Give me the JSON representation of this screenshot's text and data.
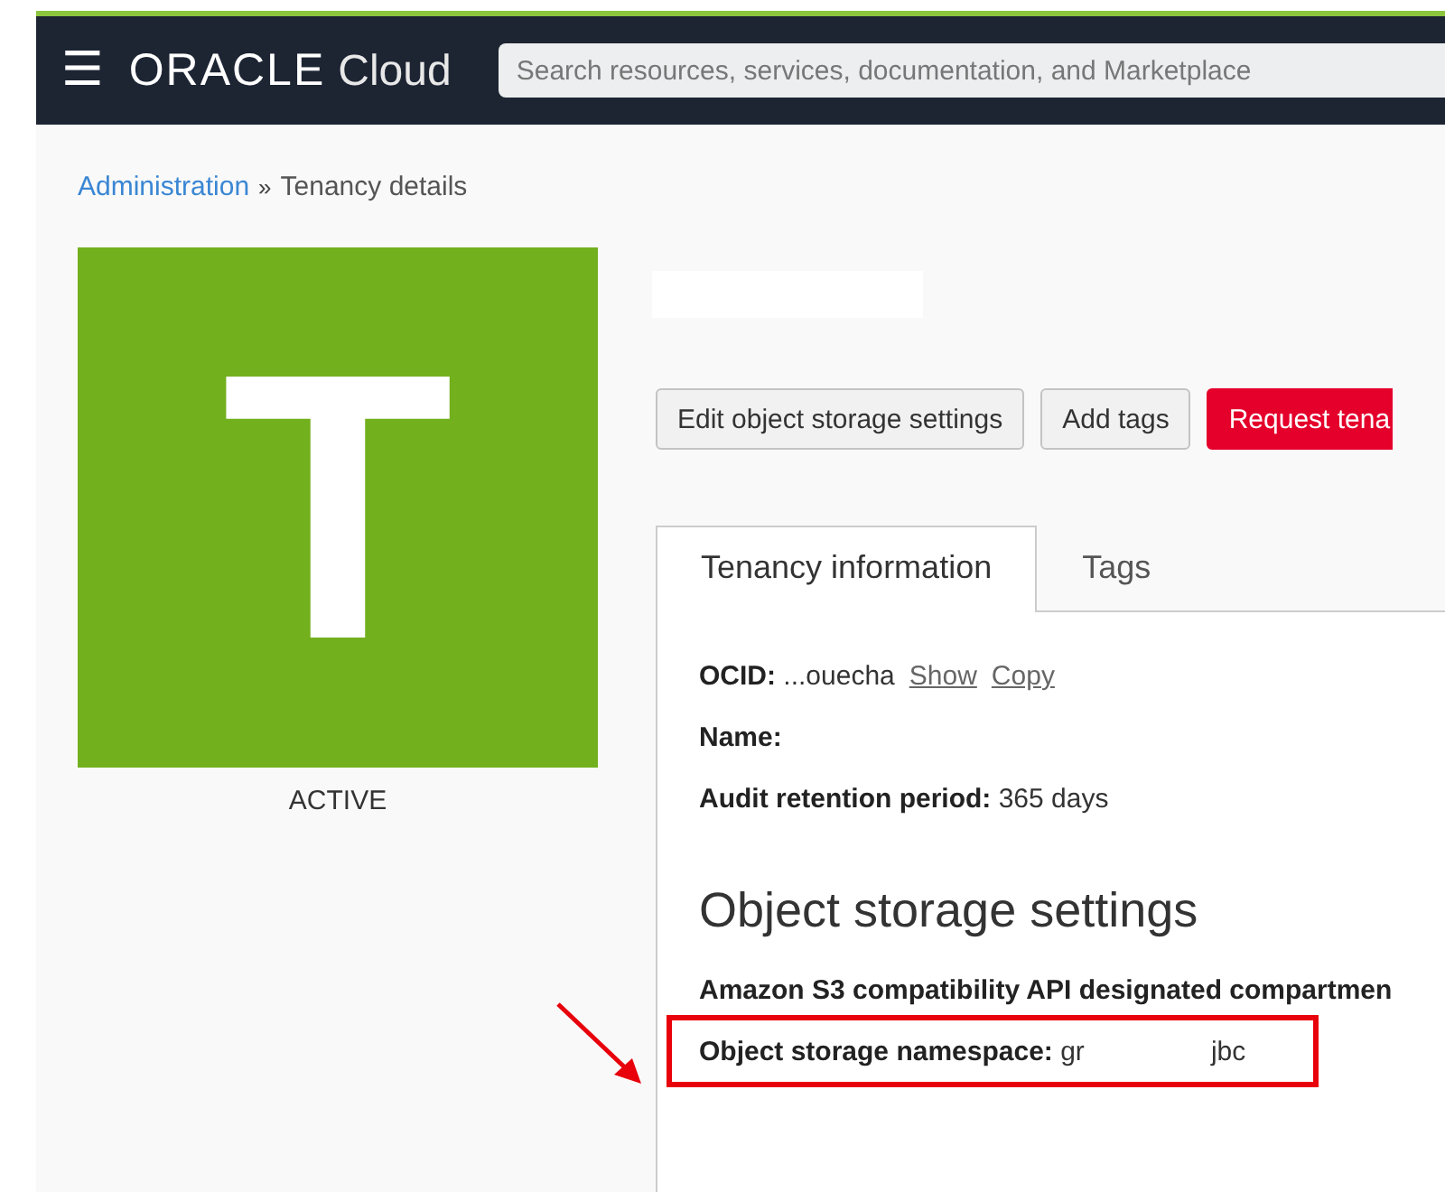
{
  "header": {
    "menu_icon": "☰",
    "logo_word": "ORACLE",
    "logo_product": "Cloud",
    "search": {
      "placeholder": "Search resources, services, documentation, and Marketplace"
    }
  },
  "breadcrumb_separator": "»",
  "breadcrumb": [
    {
      "label": "Administration",
      "kind": "link"
    },
    {
      "label": "Tenancy details",
      "kind": "current"
    }
  ],
  "tenancy": {
    "avatar_letter": "T",
    "status": "ACTIVE",
    "color": "#72b01d"
  },
  "buttons": [
    {
      "label": "Edit object storage settings",
      "kind": "secondary"
    },
    {
      "label": "Add tags",
      "kind": "secondary"
    },
    {
      "label": "Request tena",
      "kind": "danger"
    }
  ],
  "tabs": [
    {
      "label": "Tenancy information",
      "selected": true
    },
    {
      "label": "Tags",
      "selected": false
    }
  ],
  "info": [
    {
      "label": "OCID:",
      "value": "...ouecha",
      "links": [
        "Show",
        "Copy"
      ]
    },
    {
      "label": "Name:"
    },
    {
      "label": "Audit retention period:",
      "value": "365 days"
    }
  ],
  "object_storage": {
    "heading": "Object storage settings",
    "fields": [
      {
        "label": "Amazon S3 compatibility API designated compartmen",
        "highlighted": false
      },
      {
        "label": "Object storage namespace:",
        "value": "gr",
        "value_end": "jbc",
        "highlighted": true
      }
    ]
  }
}
